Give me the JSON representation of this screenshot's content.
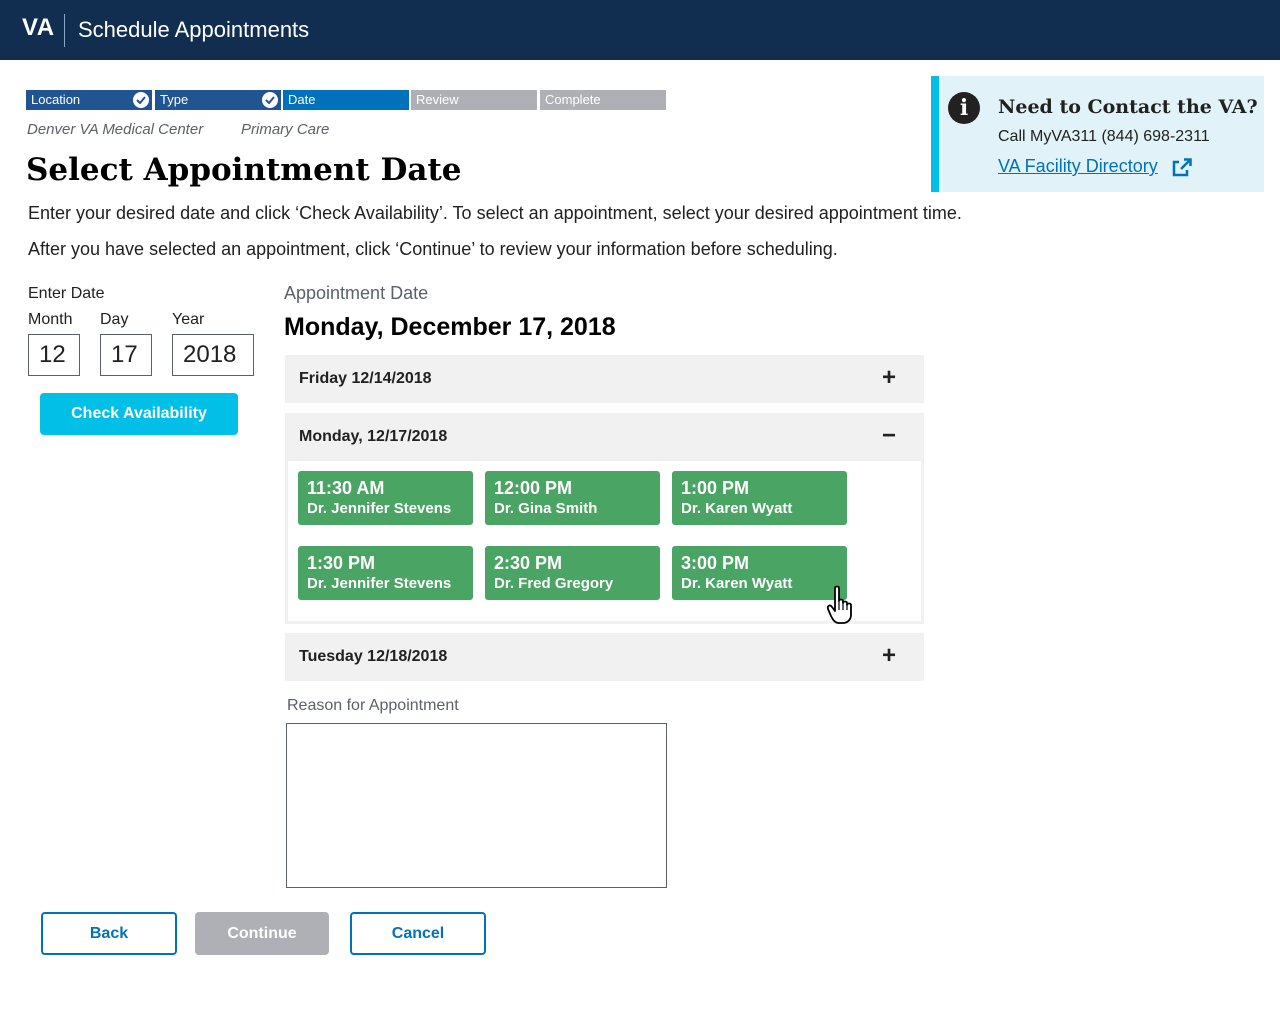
{
  "header": {
    "logo": "VA",
    "title": "Schedule Appointments"
  },
  "steps": [
    {
      "label": "Location",
      "state": "done"
    },
    {
      "label": "Type",
      "state": "done"
    },
    {
      "label": "Date",
      "state": "current"
    },
    {
      "label": "Review",
      "state": "todo"
    },
    {
      "label": "Complete",
      "state": "todo"
    }
  ],
  "breadcrumb": {
    "location": "Denver VA Medical Center",
    "type": "Primary Care"
  },
  "page_title": "Select Appointment Date",
  "instructions": [
    "Enter your desired date and click ‘Check Availability’. To select an appointment, select your desired appointment time.",
    "After you have selected an appointment, click ‘Continue’ to review your information before scheduling."
  ],
  "contact": {
    "title": "Need to Contact the VA?",
    "call": "Call MyVA311 (844) 698-2311",
    "link": "VA Facility Directory",
    "icon": "info-icon"
  },
  "date_form": {
    "label": "Enter Date",
    "month_label": "Month",
    "month_value": "12",
    "day_label": "Day",
    "day_value": "17",
    "year_label": "Year",
    "year_value": "2018",
    "check_button": "Check Availability"
  },
  "appointment": {
    "label": "Appointment Date",
    "selected_date": "Monday, December 17, 2018"
  },
  "days": [
    {
      "title": "Friday 12/14/2018",
      "sign": "+",
      "expanded": false
    },
    {
      "title": "Monday, 12/17/2018",
      "sign": "−",
      "expanded": true
    },
    {
      "title": "Tuesday 12/18/2018",
      "sign": "+",
      "expanded": false
    }
  ],
  "slots": [
    {
      "time": "11:30 AM",
      "doctor": "Dr. Jennifer Stevens"
    },
    {
      "time": "12:00 PM",
      "doctor": "Dr. Gina Smith"
    },
    {
      "time": "1:00 PM",
      "doctor": "Dr. Karen Wyatt"
    },
    {
      "time": "1:30 PM",
      "doctor": "Dr. Jennifer Stevens"
    },
    {
      "time": "2:30 PM",
      "doctor": "Dr. Fred Gregory"
    },
    {
      "time": "3:00 PM",
      "doctor": "Dr. Karen Wyatt"
    }
  ],
  "reason": {
    "label": "Reason for Appointment",
    "value": ""
  },
  "actions": {
    "back": "Back",
    "continue": "Continue",
    "cancel": "Cancel"
  },
  "colors": {
    "header": "#112e51",
    "slot": "#4aa564",
    "primary": "#0071bb",
    "accent": "#02bfe7",
    "disabled": "#aeb0b5"
  }
}
